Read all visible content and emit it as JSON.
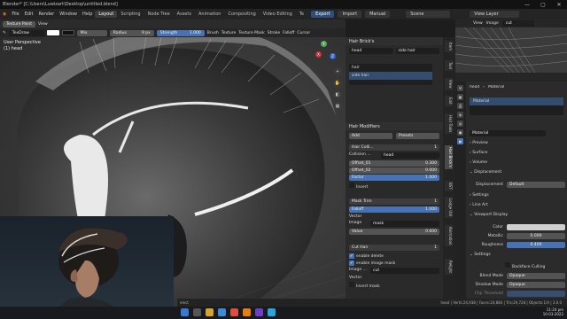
{
  "window": {
    "title": "Blender* [C:\\Users\\Luwizart\\Desktop\\untitled.blend]",
    "controls": [
      "—",
      "▢",
      "✕"
    ]
  },
  "menubar": {
    "logo": "◉",
    "menus": [
      "File",
      "Edit",
      "Render",
      "Window",
      "Help"
    ],
    "workspaces": [
      "Layout",
      "Scripting",
      "Node Tree",
      "Assets",
      "Animation",
      "Compositing",
      "Video Editing",
      "Te"
    ],
    "active_workspace": "Layout",
    "export_label": "Export",
    "import_label": "Import",
    "manual_label": "Manual",
    "scene_label": "Scene",
    "view_layer_label": "View Layer"
  },
  "viewport_header": {
    "mode": "Texture Paint",
    "view": "View",
    "brush": "TexDraw",
    "blend": "Mix",
    "radius_label": "Radius",
    "radius_value": "9 px",
    "strength_label": "Strength",
    "strength_value": "1.000",
    "menus": [
      "Brush",
      "Texture",
      "Texture Mask",
      "Stroke",
      "Falloff",
      "Cursor"
    ]
  },
  "viewport": {
    "perspective": "User Perspective",
    "object": "(1) head",
    "gizmo": {
      "x": "X",
      "y": "Y",
      "z": "Z"
    }
  },
  "hair_panel": {
    "header": "Hair Brick's",
    "object": "head",
    "object2": "side hair",
    "list": [
      "hair",
      "side hair"
    ],
    "modifiers_header": "Hair Modifiers",
    "add_label": "Add",
    "presets_label": "Presets",
    "mod1": {
      "name": "Hair Colli...",
      "count": "1",
      "collision_label": "Collision ...",
      "collision_obj": "head",
      "offset1_label": "Offset_01",
      "offset1": "0.300",
      "offset2_label": "Offset_02",
      "offset2": "0.000",
      "factor_label": "Factor",
      "factor": "1.000",
      "invert": "Invert"
    },
    "mod2": {
      "name": "Mask Trim",
      "count": "1",
      "falloff": "Falloff",
      "falloff_value": "1.000",
      "vector": "Vector",
      "image_label": "Image",
      "image": "mask",
      "value_label": "Value",
      "value": "0.600"
    },
    "mod3": {
      "name": "Cut Hair",
      "count": "1",
      "enable_delete": "enable delete",
      "enable_mask": "enable image mask",
      "image_label": "Image ...",
      "image": "cut",
      "vector": "Vector",
      "invert_mask": "Invert mask"
    }
  },
  "side_tabs": [
    "Item",
    "Tool",
    "View",
    "Edit",
    "Hair Tools",
    "Hair Brick's",
    "BST",
    "Lodge Util",
    "Animation",
    "Relight"
  ],
  "image_editor": {
    "view": "View",
    "image": "Image",
    "name": "cut"
  },
  "properties": {
    "object": "head",
    "tab": "Material",
    "material_slot": "Material",
    "material_name": "Material",
    "sections": [
      "Preview",
      "Surface",
      "Volume",
      "Displacement"
    ],
    "displacement_label": "Displacement",
    "displacement_value": "Default",
    "settings": "Settings",
    "line_art": "Line Art",
    "viewport_display": "Viewport Display",
    "color_label": "Color",
    "metallic_label": "Metallic",
    "metallic": "0.000",
    "roughness_label": "Roughness",
    "roughness": "0.400",
    "settings2": "Settings",
    "backface_label": "Backface Culling",
    "blend_mode_label": "Blend Mode",
    "blend_mode": "Opaque",
    "shadow_mode_label": "Shadow Mode",
    "shadow_mode": "Opaque",
    "clip_label": "Clip Threshold"
  },
  "status": {
    "text": "head | Verts:24,938 | Faces:24,884 | Tris:29,728 | Objects:1/4 | 3.0.0",
    "select": "elect"
  },
  "taskbar": {
    "time": "11:24 pm",
    "date": "10-03-2022"
  },
  "colors": {
    "accent": "#4772b3",
    "orange": "#e87d0d",
    "bg": "#1d1d1d"
  }
}
